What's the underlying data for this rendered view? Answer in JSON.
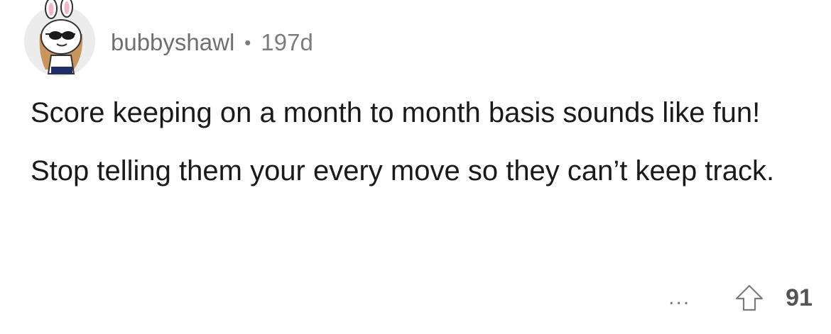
{
  "comment": {
    "username": "bubbyshawl",
    "separator": "•",
    "age": "197d",
    "paragraphs": [
      "Score keeping on a month to month basis sounds like fun!",
      "Stop telling them your every move so they can’t keep track."
    ],
    "more_label": "...",
    "score": "91"
  },
  "icons": {
    "avatar": "bunny-ears-sunglasses-avatar",
    "more": "more-options-icon",
    "upvote": "upvote-arrow-icon"
  },
  "colors": {
    "text": "#1a1a1b",
    "meta": "#7c7c7c",
    "score": "#545454"
  }
}
